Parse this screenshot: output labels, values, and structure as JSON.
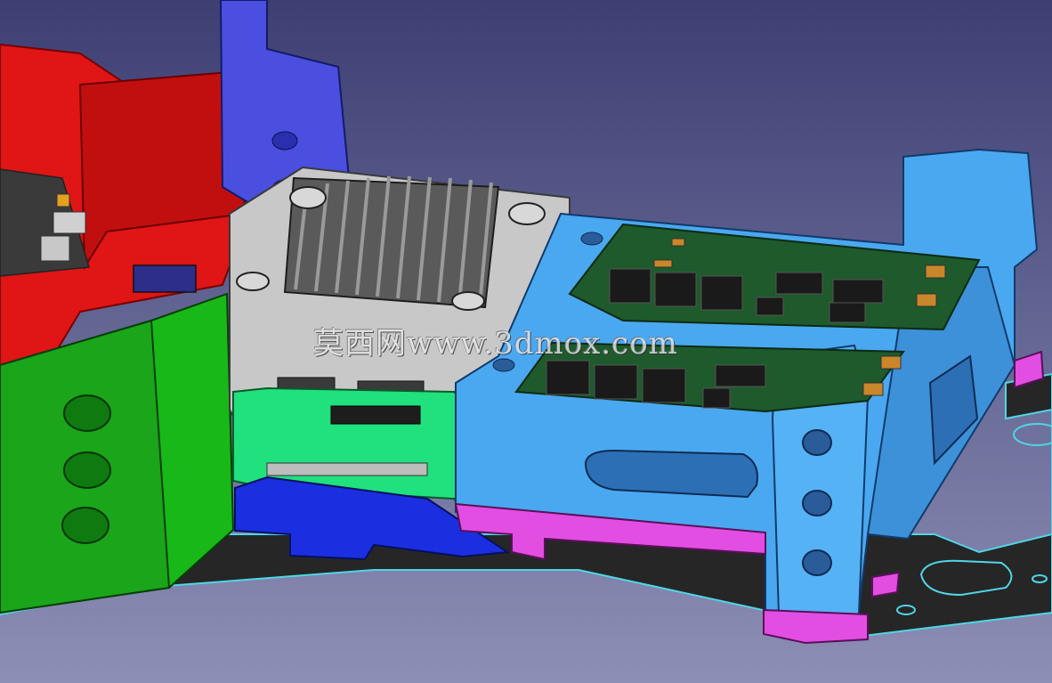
{
  "app": {
    "view": "3D model viewport"
  },
  "watermark": {
    "text": "莫西网www.3dmox.com"
  },
  "colors": {
    "background_top": "#3d3f73",
    "background_bottom": "#8d8fb6",
    "base_plate": "#262626",
    "edge_highlight": "#4fd6e6",
    "red_part": "#e01515",
    "blue_bracket": "#4a4fe0",
    "green_mount": "#18b818",
    "light_green_part": "#21e07e",
    "gray_housing": "#c8c8c8",
    "heatsink": "#5a5a5a",
    "light_blue_frame": "#4aa8f0",
    "pcb": "#1e5a2c",
    "magenta_spacer": "#e24ee2",
    "dark_blue_block": "#1b2fe0"
  }
}
